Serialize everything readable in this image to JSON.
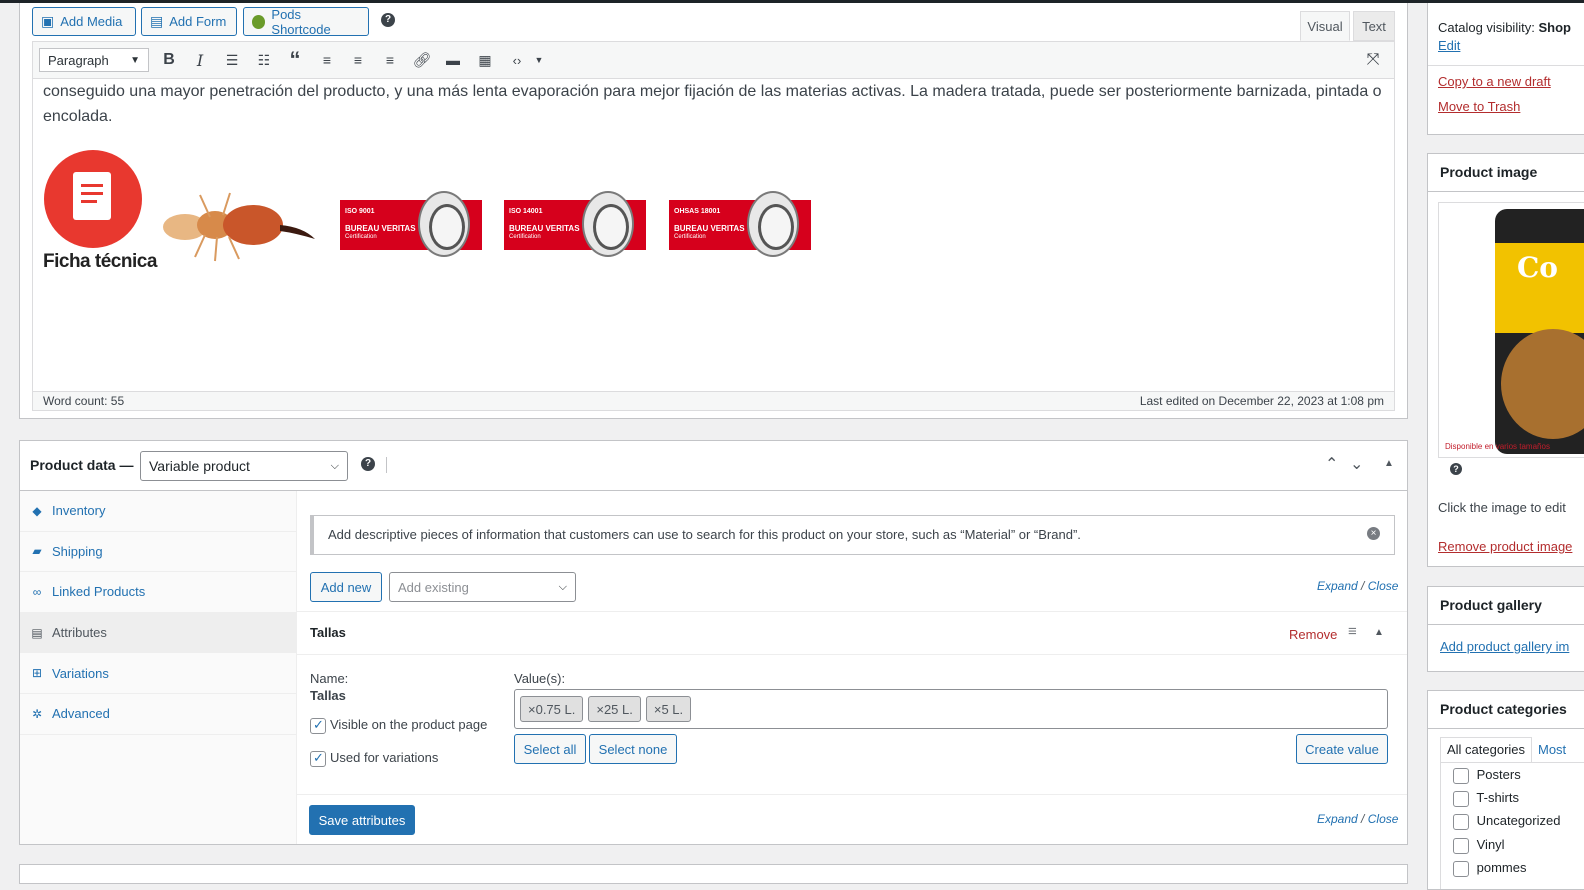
{
  "editor": {
    "buttons": {
      "add_media": "Add Media",
      "add_form": "Add Form",
      "pods_shortcode": "Pods Shortcode"
    },
    "tabs": {
      "visual": "Visual",
      "text": "Text"
    },
    "format_select": "Paragraph",
    "body_text": "conseguido una mayor penetración del producto, y una más lenta evaporación para mejor fijación de las materias activas. La madera tratada, puede ser posteriormente barnizada, pintada o encolada.",
    "ficha_label": "Ficha técnica",
    "certs": [
      {
        "code": "ISO 9001",
        "name": "BUREAU VERITAS",
        "sub": "Certification"
      },
      {
        "code": "ISO 14001",
        "name": "BUREAU VERITAS",
        "sub": "Certification"
      },
      {
        "code": "OHSAS 18001",
        "name": "BUREAU VERITAS",
        "sub": "Certification"
      }
    ],
    "word_count": "Word count: 55",
    "last_edited": "Last edited on December 22, 2023 at 1:08 pm"
  },
  "product_data": {
    "title": "Product data —",
    "type_value": "Variable product",
    "tabs": [
      {
        "label": "Inventory",
        "icon": "tag-icon"
      },
      {
        "label": "Shipping",
        "icon": "truck-icon"
      },
      {
        "label": "Linked Products",
        "icon": "link-icon"
      },
      {
        "label": "Attributes",
        "icon": "list-icon"
      },
      {
        "label": "Variations",
        "icon": "grid-icon"
      },
      {
        "label": "Advanced",
        "icon": "gear-icon"
      }
    ],
    "notice": "Add descriptive pieces of information that customers can use to search for this product on your store, such as “Material” or “Brand”.",
    "add_new": "Add new",
    "add_existing_placeholder": "Add existing",
    "expand": "Expand",
    "close": "Close",
    "separator": "/",
    "attribute": {
      "title": "Tallas",
      "remove": "Remove",
      "name_label": "Name:",
      "name_value": "Tallas",
      "visible_label": "Visible on the product page",
      "variations_label": "Used for variations",
      "values_label": "Value(s):",
      "values": [
        "0.75 L.",
        "25 L.",
        "5 L."
      ],
      "select_all": "Select all",
      "select_none": "Select none",
      "create_value": "Create value"
    },
    "save_attributes": "Save attributes"
  },
  "sidebar": {
    "catalog_visibility_label": "Catalog visibility:",
    "catalog_visibility_value": "Shop",
    "edit": "Edit",
    "copy_draft": "Copy to a new draft",
    "trash": "Move to Trash",
    "product_image_title": "Product image",
    "product_image_caption": "Disponible en varios tamaños",
    "product_image_brand": "Co",
    "click_to_edit": "Click the image to edit",
    "remove_image": "Remove product image",
    "gallery_title": "Product gallery",
    "gallery_link": "Add product gallery im",
    "categories_title": "Product categories",
    "cat_tabs": [
      "All categories",
      "Most"
    ],
    "categories": [
      "Posters",
      "T-shirts",
      "Uncategorized",
      "Vinyl",
      "pommes"
    ]
  }
}
